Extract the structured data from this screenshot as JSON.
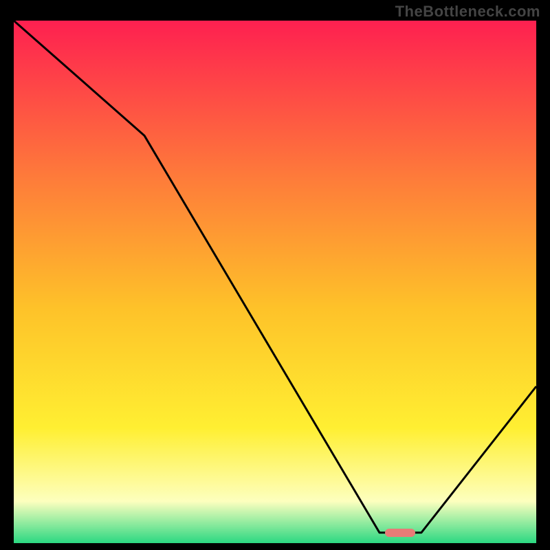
{
  "watermark": "TheBottleneck.com",
  "colors": {
    "gradient_top": "#fe2050",
    "gradient_mid_upper": "#fe7b3a",
    "gradient_mid": "#fec229",
    "gradient_mid_lower": "#ffef32",
    "gradient_pale": "#fdffbe",
    "gradient_bottom": "#2bd882",
    "curve": "#000000",
    "marker": "#e87b77",
    "frame": "#000000"
  },
  "chart_data": {
    "type": "line",
    "title": "",
    "xlabel": "",
    "ylabel": "",
    "xlim": [
      0,
      100
    ],
    "ylim": [
      0,
      100
    ],
    "x": [
      0,
      25,
      70,
      78,
      100
    ],
    "values": [
      100,
      78,
      2,
      2,
      30
    ],
    "optimal_range_x": [
      70,
      78
    ],
    "optimal_value": 2,
    "grid": false,
    "legend": false
  },
  "marker": {
    "x_center": 74,
    "y": 2
  }
}
